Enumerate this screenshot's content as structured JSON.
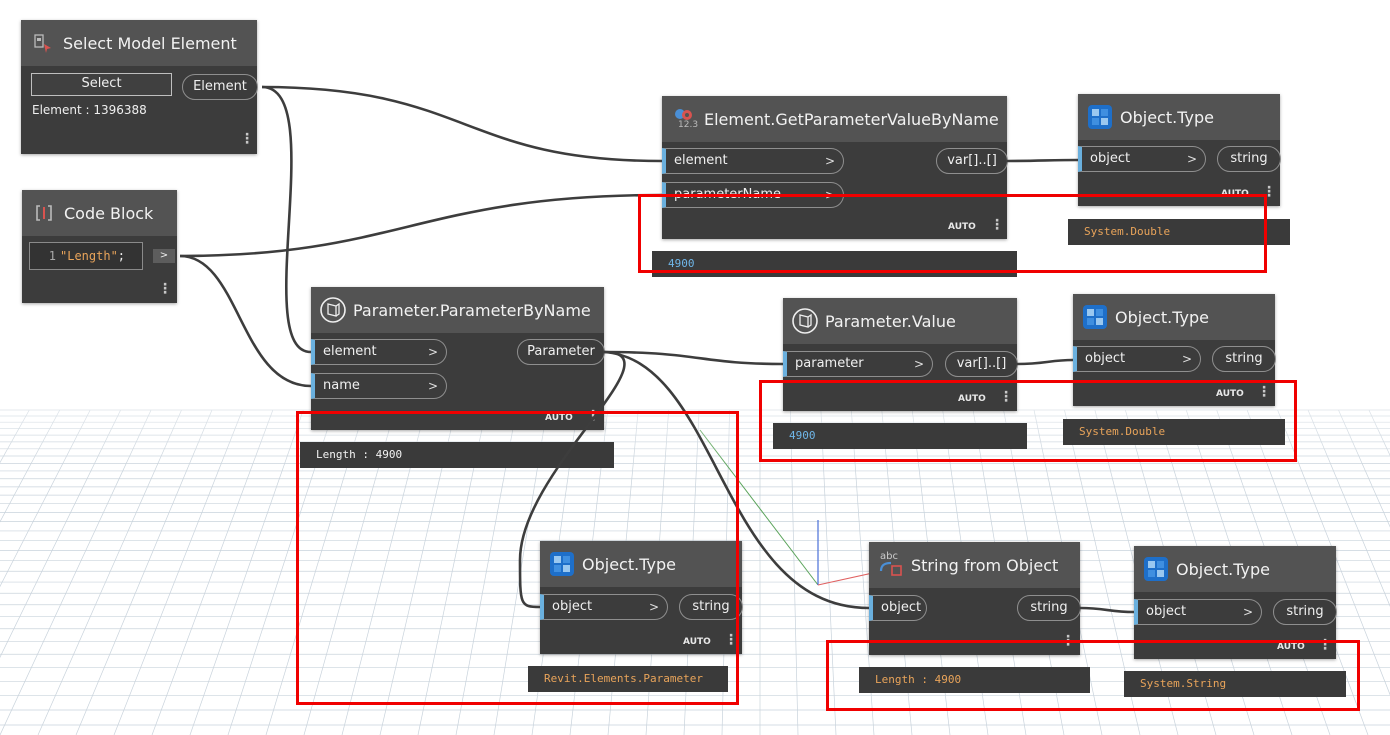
{
  "nodes": {
    "select_model": {
      "title": "Select Model Element",
      "button_label": "Select",
      "output": "Element",
      "status": "Element : 1396388"
    },
    "code_block": {
      "title": "Code Block",
      "line_number": "1",
      "code_string": "\"Length\"",
      "code_end": ";",
      "output": ">"
    },
    "get_param": {
      "title": "Element.GetParameterValueByName",
      "icon_badge": "12.3",
      "inputs": [
        "element",
        "parameterName"
      ],
      "output": "var[]..[]",
      "lacing": "AUTO",
      "preview": "4900"
    },
    "objtype_1": {
      "title": "Object.Type",
      "input": "object",
      "output": "string",
      "lacing": "AUTO",
      "preview": "System.Double"
    },
    "param_by_name": {
      "title": "Parameter.ParameterByName",
      "inputs": [
        "element",
        "name"
      ],
      "output": "Parameter",
      "lacing": "AUTO",
      "preview": "Length : 4900"
    },
    "param_value": {
      "title": "Parameter.Value",
      "input": "parameter",
      "output": "var[]..[]",
      "lacing": "AUTO",
      "preview": "4900"
    },
    "objtype_2": {
      "title": "Object.Type",
      "input": "object",
      "output": "string",
      "lacing": "AUTO",
      "preview": "System.Double"
    },
    "objtype_3": {
      "title": "Object.Type",
      "input": "object",
      "output": "string",
      "lacing": "AUTO",
      "preview": "Revit.Elements.Parameter"
    },
    "string_from_obj": {
      "title": "String from Object",
      "icon_badge": "abc",
      "input": "object",
      "output": "string",
      "preview": "Length : 4900"
    },
    "objtype_4": {
      "title": "Object.Type",
      "input": "object",
      "output": "string",
      "lacing": "AUTO",
      "preview": "System.String"
    }
  },
  "colors": {
    "node_body": "#3c3c3c",
    "node_header": "#535353",
    "input_accent": "#6ab0de",
    "preview_number": "#6fb6e8",
    "preview_type": "#e9a45a",
    "highlight_box": "#f00000",
    "wire": "#3d3d3d"
  }
}
